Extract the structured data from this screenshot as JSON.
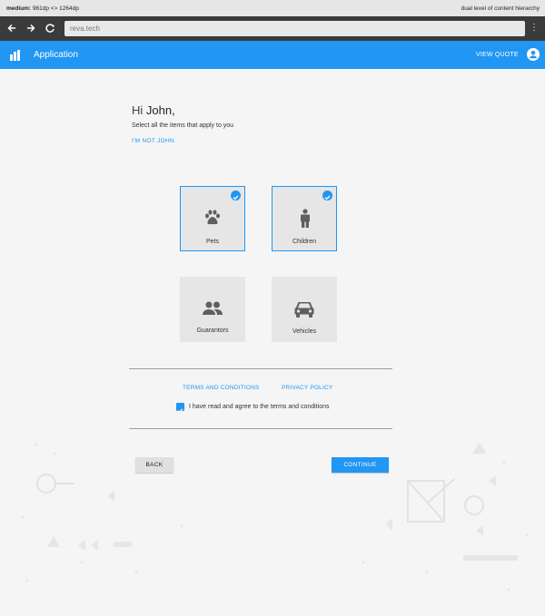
{
  "device_bar": {
    "size_label": "medium:",
    "size_value": "961dp <> 1264dp",
    "right_text": "dual level of content hierarchy"
  },
  "browser": {
    "url": "reva.tech"
  },
  "appbar": {
    "title": "Application",
    "view_quote": "VIEW QUOTE"
  },
  "greeting": {
    "hi": "Hi",
    "name": "John,",
    "subtitle": "Select all the items that apply to you",
    "not_user": "I'M NOT JOHN"
  },
  "options": [
    {
      "label": "Pets",
      "icon": "paw-icon",
      "selected": true
    },
    {
      "label": "Children",
      "icon": "child-icon",
      "selected": true
    },
    {
      "label": "Guarantors",
      "icon": "people-icon",
      "selected": false
    },
    {
      "label": "Vehicles",
      "icon": "car-icon",
      "selected": false
    }
  ],
  "legal": {
    "terms": "TERMS AND CONDITIONS",
    "privacy": "PRIVACY POLICY",
    "agree_label": "I have read and agree to the terms and conditions",
    "agree_checked": true
  },
  "actions": {
    "back": "BACK",
    "continue": "CONTINUE"
  },
  "colors": {
    "accent": "#2196f3",
    "card_bg": "#e6e6e6",
    "icon": "#5f5f5f"
  }
}
